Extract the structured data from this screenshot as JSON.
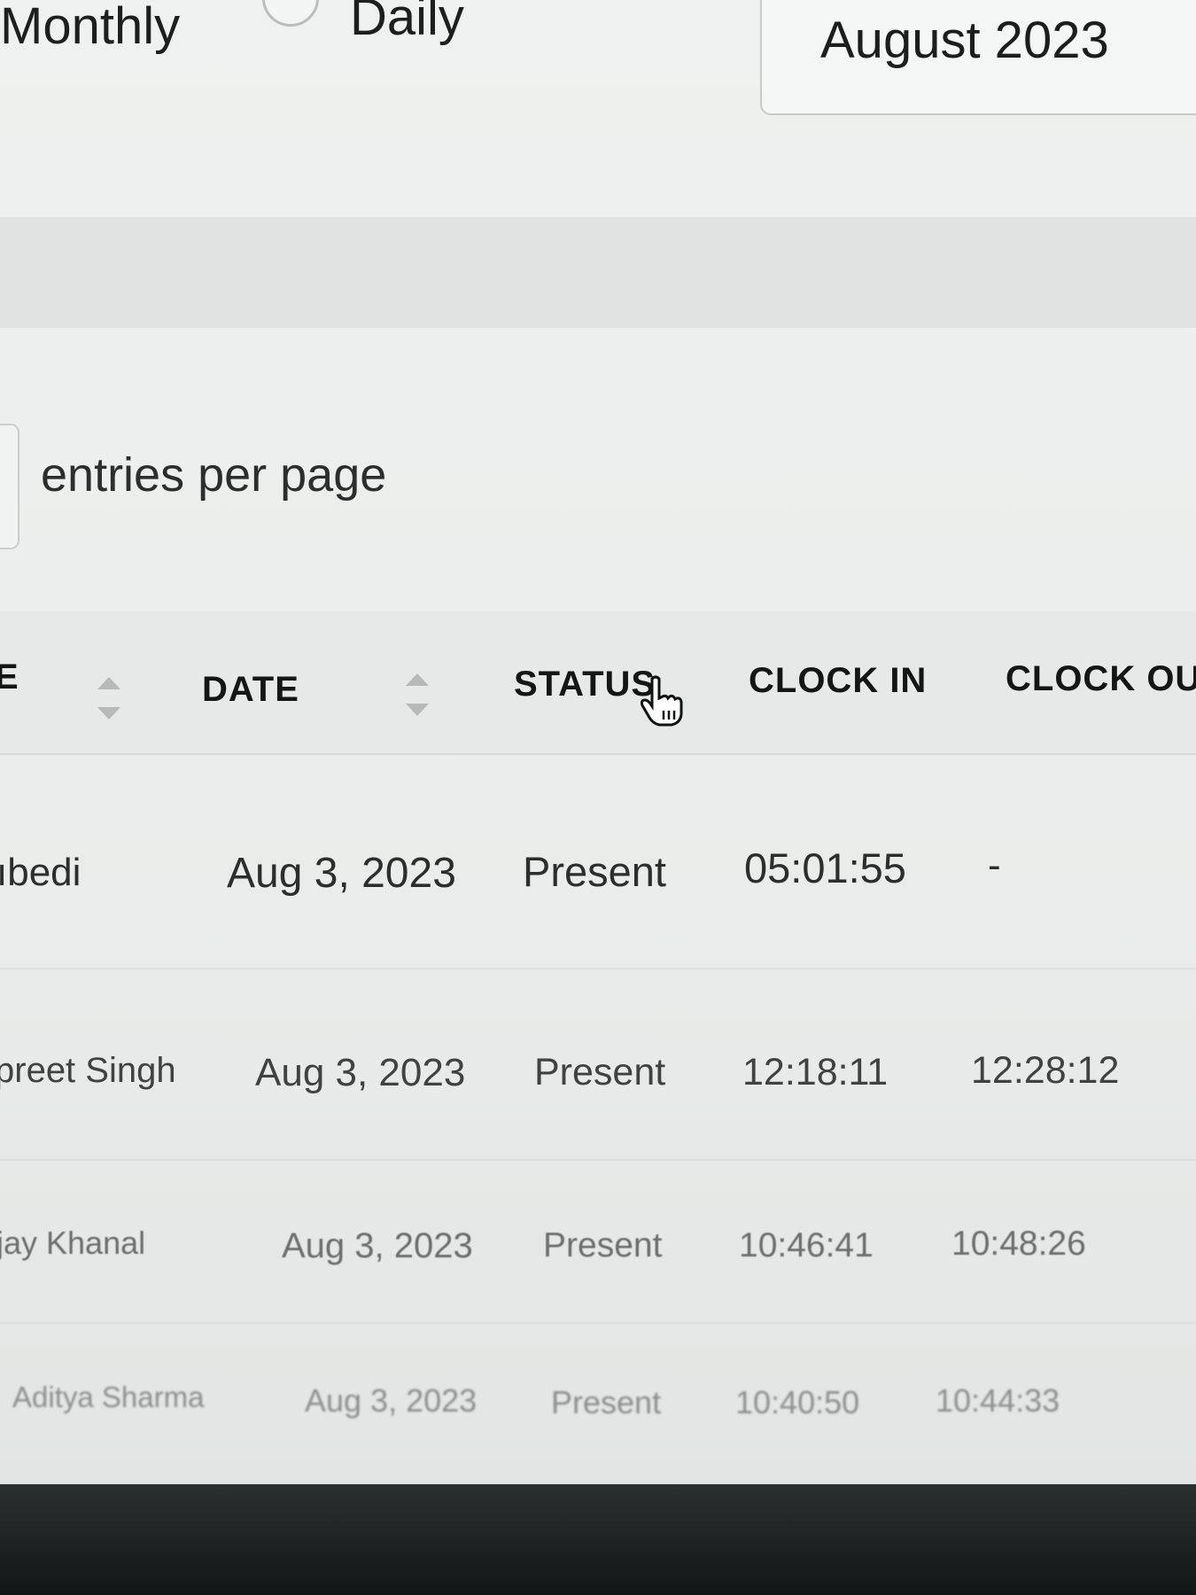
{
  "period_selector": {
    "options": [
      {
        "label": "Monthly",
        "selected": true
      },
      {
        "label": "Daily",
        "selected": false
      }
    ],
    "month_value": "August 2023"
  },
  "pagination": {
    "per_page_label": "entries per page"
  },
  "table": {
    "columns": [
      "E",
      "DATE",
      "STATUS",
      "CLOCK IN",
      "CLOCK OU"
    ],
    "rows": [
      {
        "name": "ıbedi",
        "date": "Aug 3, 2023",
        "status": "Present",
        "clock_in": "05:01:55",
        "clock_out": "-"
      },
      {
        "name": "preet Singh",
        "date": "Aug 3, 2023",
        "status": "Present",
        "clock_in": "12:18:11",
        "clock_out": "12:28:12"
      },
      {
        "name": "jay Khanal",
        "date": "Aug 3, 2023",
        "status": "Present",
        "clock_in": "10:46:41",
        "clock_out": "10:48:26"
      },
      {
        "name": "Aditya Sharma",
        "date": "Aug 3, 2023",
        "status": "Present",
        "clock_in": "10:40:50",
        "clock_out": "10:44:33"
      }
    ]
  },
  "colors": {
    "background": "#eceeed",
    "header_text": "#141616",
    "bezel": "#1a1e1e"
  }
}
